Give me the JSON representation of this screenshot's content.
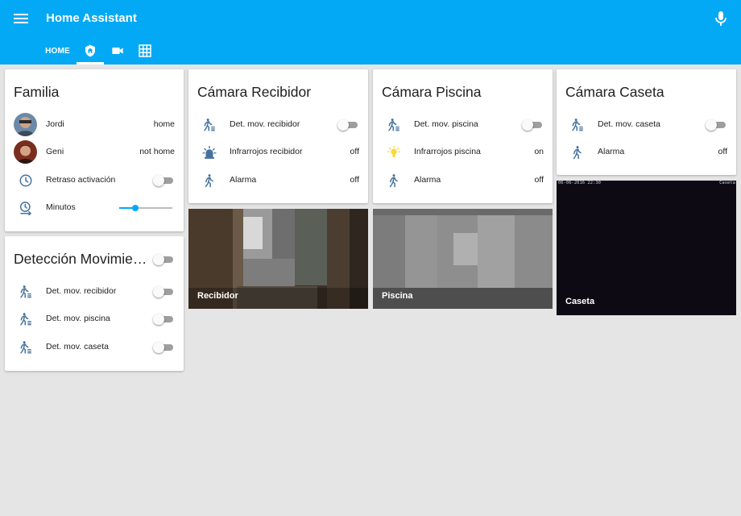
{
  "app": {
    "title": "Home Assistant"
  },
  "tabs": [
    {
      "label": "HOME",
      "active": false
    },
    {
      "icon": "shield-home-icon",
      "active": true
    },
    {
      "icon": "video-camera-icon",
      "active": false
    },
    {
      "icon": "grid-icon",
      "active": false
    }
  ],
  "colors": {
    "accent": "#03a9f4",
    "icon": "#44739e",
    "active_icon": "#fdd835",
    "background": "#e5e5e5"
  },
  "familia": {
    "title": "Familia",
    "rows": [
      {
        "name": "Jordi",
        "state": "home"
      },
      {
        "name": "Geni",
        "state": "not home"
      },
      {
        "name": "Retraso activación",
        "icon": "clock-icon",
        "toggle": false
      },
      {
        "name": "Minutos",
        "icon": "timer-icon",
        "slider_fraction": 0.31
      }
    ]
  },
  "deteccion": {
    "title": "Detección Movimie…",
    "toggle": false,
    "rows": [
      {
        "name": "Det. mov. recibidor",
        "icon": "motion-icon",
        "toggle": false
      },
      {
        "name": "Det. mov. piscina",
        "icon": "motion-icon",
        "toggle": false
      },
      {
        "name": "Det. mov. caseta",
        "icon": "motion-icon",
        "toggle": false
      }
    ]
  },
  "recibidor": {
    "title": "Cámara Recibidor",
    "rows": [
      {
        "name": "Det. mov. recibidor",
        "icon": "motion-icon",
        "toggle": false
      },
      {
        "name": "Infrarrojos recibidor",
        "icon": "alarm-light-icon",
        "state": "off"
      },
      {
        "name": "Alarma",
        "icon": "walk-icon",
        "state": "off"
      }
    ],
    "camera_label": "Recibidor"
  },
  "piscina": {
    "title": "Cámara Piscina",
    "rows": [
      {
        "name": "Det. mov. piscina",
        "icon": "motion-icon",
        "toggle": false
      },
      {
        "name": "Infrarrojos piscina",
        "icon": "lightbulb-icon",
        "state": "on"
      },
      {
        "name": "Alarma",
        "icon": "walk-icon",
        "state": "off"
      }
    ],
    "camera_label": "Piscina"
  },
  "caseta": {
    "title": "Cámara Caseta",
    "rows": [
      {
        "name": "Det. mov. caseta",
        "icon": "motion-icon",
        "toggle": false
      },
      {
        "name": "Alarma",
        "icon": "walk-icon",
        "state": "off"
      }
    ],
    "camera_label": "Caseta",
    "camera_timestamp": "06-06-2016 22:30",
    "camera_overlay_title": "Caseta"
  }
}
